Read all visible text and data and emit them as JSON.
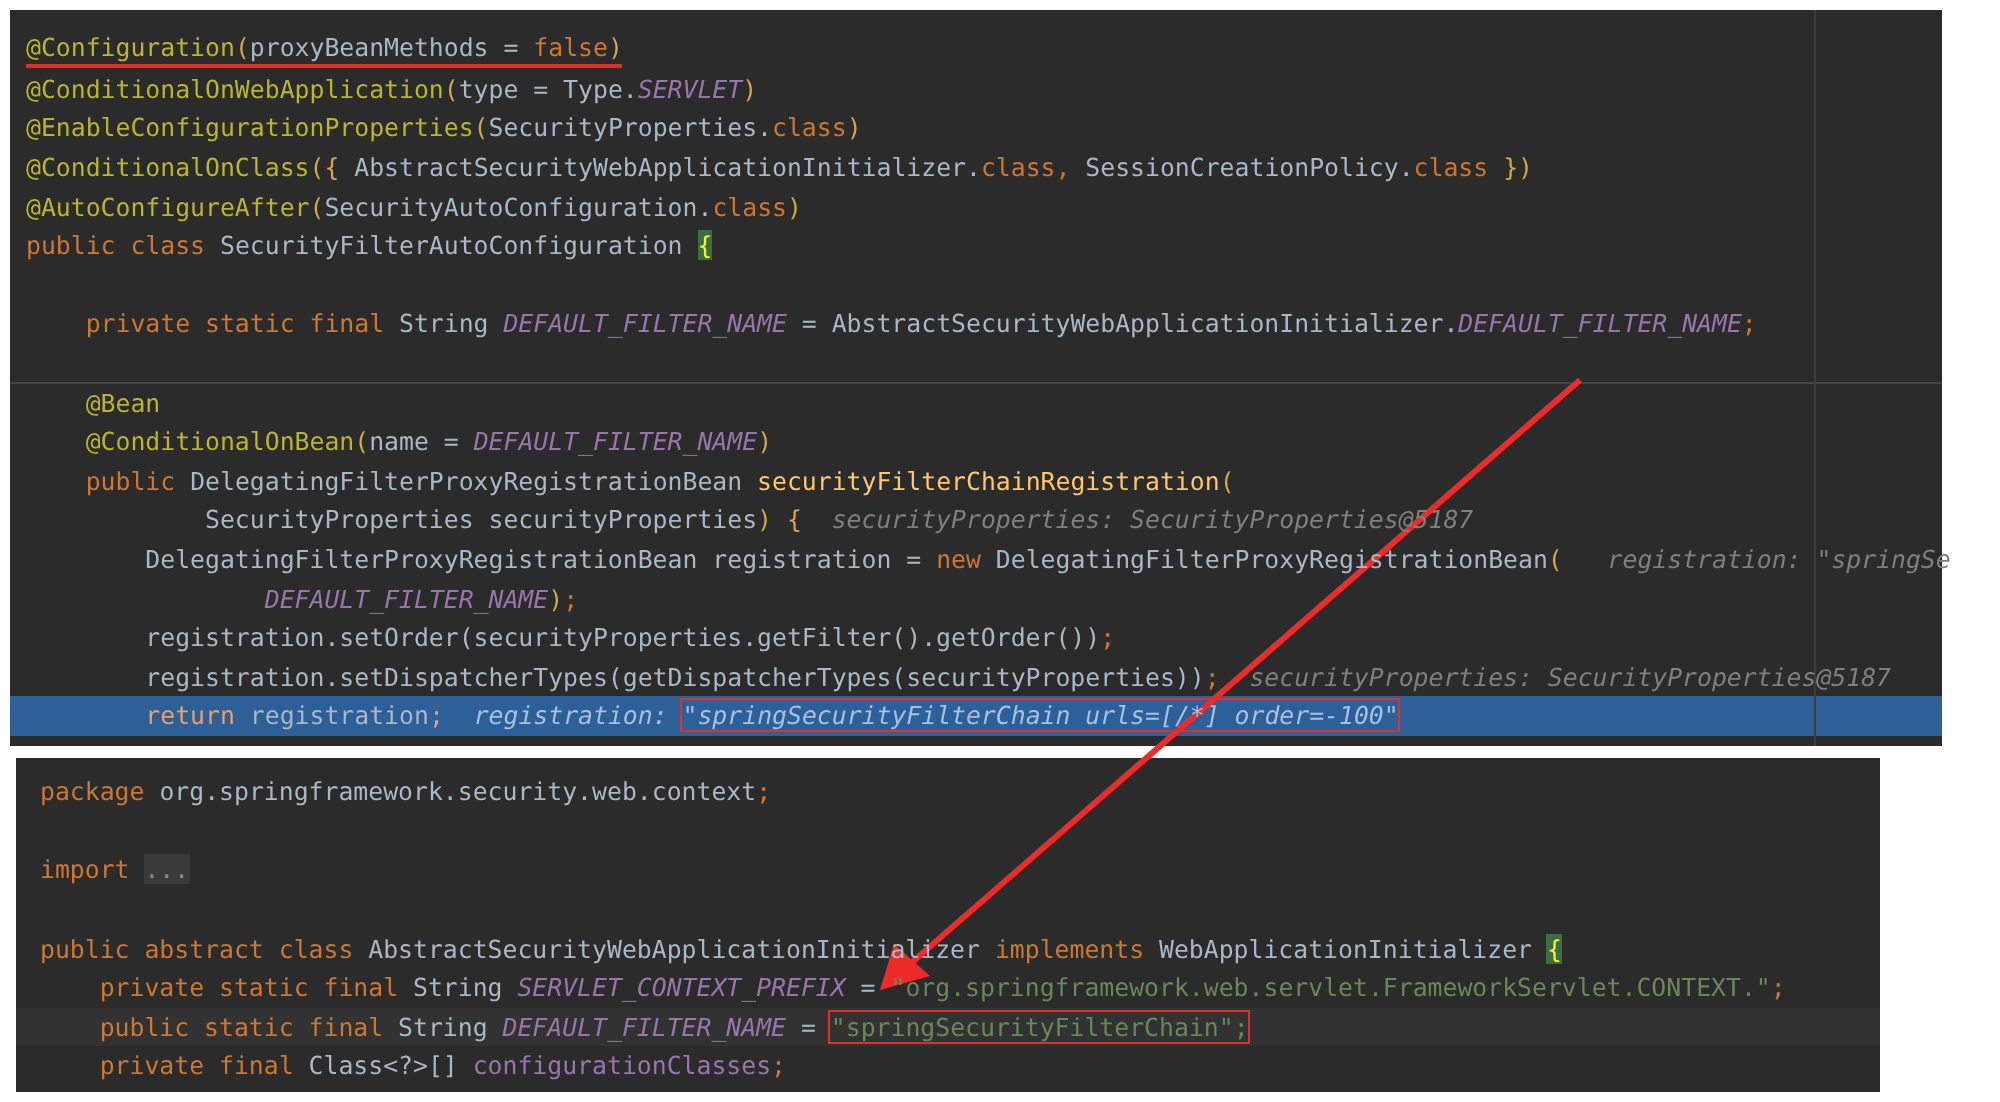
{
  "panels": [
    {
      "kind": "upper",
      "lines": [
        {
          "kind": "underlined",
          "tokens": [
            {
              "text": "@Configuration",
              "kind": "ann"
            },
            {
              "text": "(",
              "kind": "paren"
            },
            {
              "text": "proxyBeanMethods = ",
              "kind": "plain"
            },
            {
              "text": "false",
              "kind": "kw"
            },
            {
              "text": ")",
              "kind": "paren"
            }
          ]
        },
        {
          "kind": "normal",
          "tokens": [
            {
              "text": "@ConditionalOnWebApplication",
              "kind": "ann"
            },
            {
              "text": "(",
              "kind": "paren"
            },
            {
              "text": "type = Type.",
              "kind": "plain"
            },
            {
              "text": "SERVLET",
              "kind": "const"
            },
            {
              "text": ")",
              "kind": "paren"
            }
          ]
        },
        {
          "kind": "normal",
          "tokens": [
            {
              "text": "@EnableConfigurationProperties",
              "kind": "ann"
            },
            {
              "text": "(",
              "kind": "paren"
            },
            {
              "text": "SecurityProperties.",
              "kind": "plain"
            },
            {
              "text": "class",
              "kind": "kw"
            },
            {
              "text": ")",
              "kind": "paren"
            }
          ]
        },
        {
          "kind": "normal",
          "tokens": [
            {
              "text": "@ConditionalOnClass",
              "kind": "ann"
            },
            {
              "text": "({ ",
              "kind": "paren"
            },
            {
              "text": "AbstractSecurityWebApplicationInitializer.",
              "kind": "plain"
            },
            {
              "text": "class, ",
              "kind": "kw"
            },
            {
              "text": "SessionCreationPolicy.",
              "kind": "plain"
            },
            {
              "text": "class",
              "kind": "kw"
            },
            {
              "text": " })",
              "kind": "paren"
            }
          ]
        },
        {
          "kind": "normal",
          "tokens": [
            {
              "text": "@AutoConfigureAfter",
              "kind": "ann"
            },
            {
              "text": "(",
              "kind": "paren"
            },
            {
              "text": "SecurityAutoConfiguration.",
              "kind": "plain"
            },
            {
              "text": "class",
              "kind": "kw"
            },
            {
              "text": ")",
              "kind": "paren"
            }
          ]
        },
        {
          "kind": "normal",
          "tokens": [
            {
              "text": "public class ",
              "kind": "kw"
            },
            {
              "text": "SecurityFilterAutoConfiguration ",
              "kind": "plain"
            },
            {
              "text": "{",
              "kind": "brace"
            }
          ]
        },
        {
          "kind": "blank"
        },
        {
          "kind": "normal",
          "tokens": [
            {
              "text": "    private static final ",
              "kind": "kw"
            },
            {
              "text": "String ",
              "kind": "plain"
            },
            {
              "text": "DEFAULT_FILTER_NAME",
              "kind": "const"
            },
            {
              "text": " = AbstractSecurityWebApplicationInitializer.",
              "kind": "plain"
            },
            {
              "text": "DEFAULT_FILTER_NAME",
              "kind": "const"
            },
            {
              "text": ";",
              "kind": "kw"
            }
          ]
        },
        {
          "kind": "blank"
        },
        {
          "kind": "separated",
          "tokens": [
            {
              "text": "    @Bean",
              "kind": "ann"
            }
          ]
        },
        {
          "kind": "normal",
          "tokens": [
            {
              "text": "    @ConditionalOnBean",
              "kind": "ann"
            },
            {
              "text": "(",
              "kind": "paren"
            },
            {
              "text": "name = ",
              "kind": "plain"
            },
            {
              "text": "DEFAULT_FILTER_NAME",
              "kind": "const"
            },
            {
              "text": ")",
              "kind": "paren"
            }
          ]
        },
        {
          "kind": "normal",
          "tokens": [
            {
              "text": "    public ",
              "kind": "kw"
            },
            {
              "text": "DelegatingFilterProxyRegistrationBean ",
              "kind": "plain"
            },
            {
              "text": "securityFilterChainRegistration",
              "kind": "method"
            },
            {
              "text": "(",
              "kind": "paren"
            }
          ]
        },
        {
          "kind": "normal",
          "tokens": [
            {
              "text": "            SecurityProperties securityProperties",
              "kind": "plain"
            },
            {
              "text": ") {",
              "kind": "paren"
            },
            {
              "text": "  securityProperties: SecurityProperties@5187",
              "kind": "hint"
            }
          ]
        },
        {
          "kind": "normal",
          "tokens": [
            {
              "text": "        DelegatingFilterProxyRegistrationBean registration = ",
              "kind": "plain"
            },
            {
              "text": "new ",
              "kind": "kw"
            },
            {
              "text": "DelegatingFilterProxyRegistrationBean",
              "kind": "plain"
            },
            {
              "text": "(",
              "kind": "paren"
            },
            {
              "text": "   registration: \"springSe",
              "kind": "hint"
            }
          ]
        },
        {
          "kind": "normal",
          "tokens": [
            {
              "text": "                DEFAULT_FILTER_NAME",
              "kind": "const"
            },
            {
              "text": ")",
              "kind": "paren"
            },
            {
              "text": ";",
              "kind": "kw"
            }
          ]
        },
        {
          "kind": "normal",
          "tokens": [
            {
              "text": "        registration.setOrder(securityProperties.getFilter().getOrder())",
              "kind": "plain"
            },
            {
              "text": ";",
              "kind": "kw"
            }
          ]
        },
        {
          "kind": "normal",
          "tokens": [
            {
              "text": "        registration.setDispatcherTypes(getDispatcherTypes(securityProperties))",
              "kind": "plain"
            },
            {
              "text": ";",
              "kind": "kw"
            },
            {
              "text": "  securityProperties: SecurityProperties@5187",
              "kind": "hint"
            }
          ]
        },
        {
          "kind": "execution",
          "tokens": [
            {
              "text": "        return ",
              "kind": "kw"
            },
            {
              "text": "registration",
              "kind": "plain"
            },
            {
              "text": ";",
              "kind": "kw"
            },
            {
              "text": "  registration: ",
              "kind": "hint"
            },
            {
              "text": "\"springSecurityFilterChain urls=[/*] order=-100\"",
              "kind": "hint",
              "boxed": true
            }
          ]
        }
      ]
    },
    {
      "kind": "lower",
      "lines": [
        {
          "kind": "normal",
          "tokens": [
            {
              "text": "package ",
              "kind": "kw"
            },
            {
              "text": "org.springframework.security.web.context",
              "kind": "plain"
            },
            {
              "text": ";",
              "kind": "kw"
            }
          ]
        },
        {
          "kind": "blank"
        },
        {
          "kind": "normal",
          "tokens": [
            {
              "text": "import ",
              "kind": "kw"
            },
            {
              "text": "...",
              "kind": "fold"
            }
          ]
        },
        {
          "kind": "blank"
        },
        {
          "kind": "normal",
          "tokens": [
            {
              "text": "public abstract class ",
              "kind": "kw"
            },
            {
              "text": "AbstractSecurityWebApplicationInitializer ",
              "kind": "plain"
            },
            {
              "text": "implements ",
              "kind": "kw"
            },
            {
              "text": "WebApplicationInitializer ",
              "kind": "plain"
            },
            {
              "text": "{",
              "kind": "brace"
            }
          ]
        },
        {
          "kind": "normal",
          "tokens": [
            {
              "text": "    private static final ",
              "kind": "kw"
            },
            {
              "text": "String ",
              "kind": "plain"
            },
            {
              "text": "SERVLET_CONTEXT_PREFIX",
              "kind": "const"
            },
            {
              "text": " = ",
              "kind": "plain"
            },
            {
              "text": "\"org.springframework.web.servlet.FrameworkServlet.CONTEXT.\"",
              "kind": "str"
            },
            {
              "text": ";",
              "kind": "kw"
            }
          ]
        },
        {
          "kind": "caret",
          "tokens": [
            {
              "text": "    public static final ",
              "kind": "kw"
            },
            {
              "text": "String ",
              "kind": "plain"
            },
            {
              "text": "DEFAULT_FILTER_NAME",
              "kind": "const"
            },
            {
              "text": " = ",
              "kind": "plain"
            },
            {
              "text": "\"springSecurityFilterChain\";",
              "kind": "str",
              "boxed": true
            }
          ]
        },
        {
          "kind": "normal",
          "tokens": [
            {
              "text": "    private final ",
              "kind": "kw"
            },
            {
              "text": "Class<?>[] ",
              "kind": "plain"
            },
            {
              "text": "configurationClasses",
              "kind": "field"
            },
            {
              "text": ";",
              "kind": "kw"
            }
          ]
        }
      ]
    }
  ]
}
